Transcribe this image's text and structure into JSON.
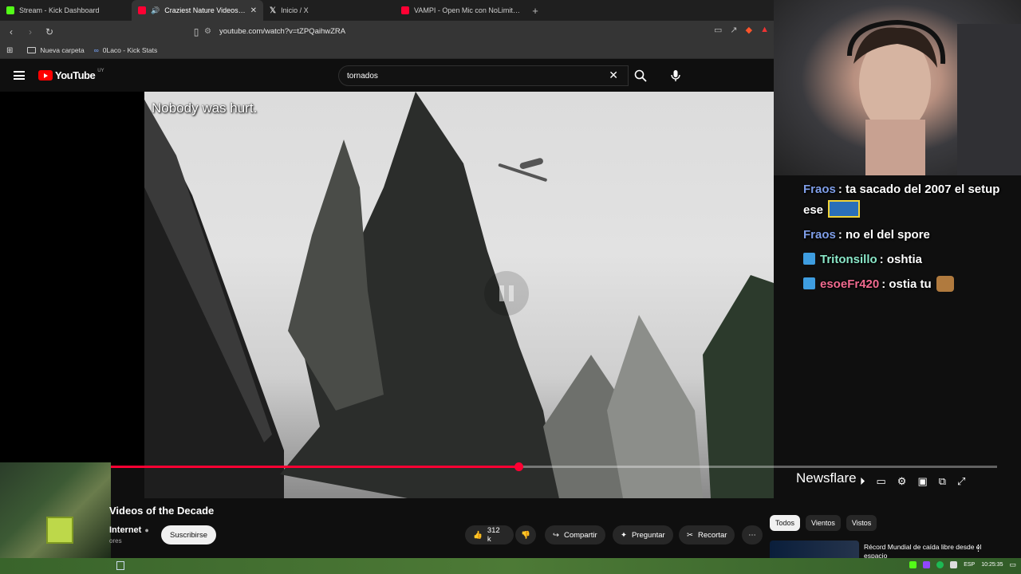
{
  "browser": {
    "tabs": [
      {
        "title": "Stream - Kick Dashboard",
        "favicon_color": "#53fc18",
        "active": false
      },
      {
        "title": "Craziest Nature Videos of the",
        "favicon_color": "#ff0033",
        "active": true
      },
      {
        "title": "Inicio / X",
        "favicon_color": "#ffffff",
        "active": false
      },
      {
        "title": "VAMPI - Open Mic con NoLimitAdro",
        "favicon_color": "#ff0033",
        "active": false
      }
    ],
    "url": "youtube.com/watch?v=tZPQaihwZRA",
    "bookmarks": [
      {
        "label": "Nueva carpeta",
        "icon": "folder-icon"
      },
      {
        "label": "0Laco - Kick Stats",
        "icon": "kick-stats-icon"
      }
    ]
  },
  "youtube": {
    "logo_text": "YouTube",
    "country_code": "UY",
    "search_value": "tornados"
  },
  "video": {
    "caption": "Nobody was hurt.",
    "watermark": "Newsflare",
    "progress_fraction": 0.46,
    "title": "Videos of the Decade",
    "channel": "Internet",
    "subs_text": "ores",
    "subscribe_label": "Suscribirse",
    "likes": "312 k",
    "share_label": "Compartir",
    "ask_label": "Preguntar",
    "clip_label": "Recortar"
  },
  "chat": [
    {
      "user": "Fraos",
      "user_color": "#7f9ee8",
      "text": ": ta sacado del 2007 el setup ese",
      "badge": false,
      "emote": "emote-car"
    },
    {
      "user": "Fraos",
      "user_color": "#7f9ee8",
      "text": ": no el del spore",
      "badge": false,
      "emote": ""
    },
    {
      "user": "Tritonsillo",
      "user_color": "#8be8c9",
      "text": ": oshtia",
      "badge": true,
      "emote": ""
    },
    {
      "user": "esoeFr420",
      "user_color": "#f06a8f",
      "text": ": ostia tu",
      "badge": true,
      "emote": "emote-dog"
    }
  ],
  "sidebar": {
    "chips": [
      "Todos",
      "Vientos",
      "Vistos"
    ],
    "related_title": "Récord Mundial de caída libre desde el espacio"
  },
  "taskbar": {
    "lang": "ESP",
    "time": "10:25:35"
  }
}
